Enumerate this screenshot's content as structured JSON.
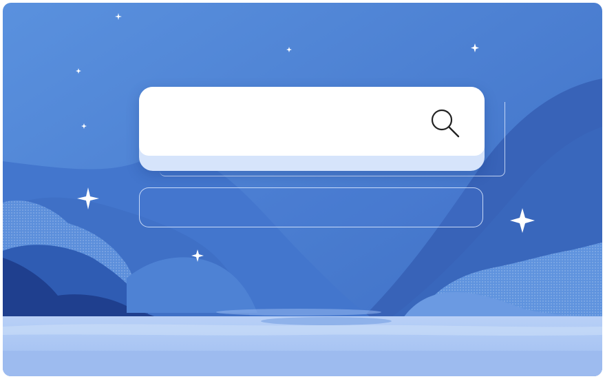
{
  "scene": {
    "colors": {
      "sky_top": "#4e86d8",
      "sky_bottom": "#3d6fc6",
      "hill_back": "#3a66bd",
      "hill_dark": "#20408f",
      "water": "#a9c5f3",
      "water_light": "#c2d7f7",
      "accent_white": "#ffffff"
    },
    "sparkles": "sparkle-icon"
  },
  "search": {
    "value": "",
    "placeholder": "",
    "icon": "search-icon"
  },
  "secondary_field": {
    "value": ""
  }
}
